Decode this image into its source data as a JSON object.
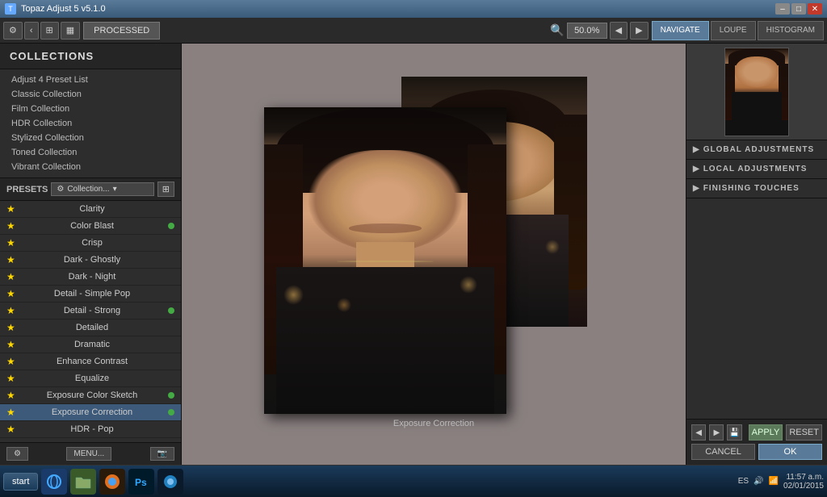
{
  "titlebar": {
    "title": "Topaz Adjust 5 v5.1.0",
    "min": "–",
    "max": "□",
    "close": "✕"
  },
  "toolbar": {
    "nav_left": "‹",
    "nav_right": "›",
    "view_mode1": "⊞",
    "view_mode2": "▦",
    "processed_label": "PROCESSED",
    "zoom_icon": "🔍",
    "zoom_value": "50.0%",
    "nav_prev": "◀",
    "nav_next": "▶"
  },
  "nav_tabs": [
    {
      "id": "navigate",
      "label": "NAVIGATE",
      "active": true
    },
    {
      "id": "loupe",
      "label": "LOUPE",
      "active": false
    },
    {
      "id": "histogram",
      "label": "HISTOGRAM",
      "active": false
    }
  ],
  "collections": {
    "header": "COLLECTIONS",
    "items": [
      {
        "label": "Adjust 4 Preset List"
      },
      {
        "label": "Classic Collection"
      },
      {
        "label": "Film Collection"
      },
      {
        "label": "HDR Collection"
      },
      {
        "label": "Stylized Collection"
      },
      {
        "label": "Toned Collection"
      },
      {
        "label": "Vibrant Collection"
      }
    ]
  },
  "presets": {
    "label": "PRESETS",
    "dropdown_label": "Collection...",
    "grid_icon": "⊞",
    "items": [
      {
        "name": "Clarity",
        "fav": true,
        "dot": false
      },
      {
        "name": "Color Blast",
        "fav": true,
        "dot": true
      },
      {
        "name": "Crisp",
        "fav": true,
        "dot": false
      },
      {
        "name": "Dark - Ghostly",
        "fav": true,
        "dot": false
      },
      {
        "name": "Dark - Night",
        "fav": true,
        "dot": false
      },
      {
        "name": "Detail - Simple Pop",
        "fav": true,
        "dot": false
      },
      {
        "name": "Detail - Strong",
        "fav": true,
        "dot": true
      },
      {
        "name": "Detailed",
        "fav": true,
        "dot": false
      },
      {
        "name": "Dramatic",
        "fav": true,
        "dot": false
      },
      {
        "name": "Enhance Contrast",
        "fav": true,
        "dot": false
      },
      {
        "name": "Equalize",
        "fav": true,
        "dot": false
      },
      {
        "name": "Exposure Color Sketch",
        "fav": true,
        "dot": true
      },
      {
        "name": "Exposure Correction",
        "fav": true,
        "dot": true,
        "active": true
      },
      {
        "name": "HDR - Pop",
        "fav": true,
        "dot": false
      }
    ]
  },
  "canvas": {
    "caption": "Exposure Correction"
  },
  "right_panel": {
    "adjustments": [
      {
        "label": "GLOBAL ADJUSTMENTS"
      },
      {
        "label": "LOCAL ADJUSTMENTS"
      },
      {
        "label": "FINISHING TOUCHES"
      }
    ]
  },
  "buttons": {
    "apply": "APPLY",
    "reset": "RESET",
    "cancel": "CANCEL",
    "ok": "OK",
    "menu": "MENU..."
  },
  "taskbar": {
    "start": "start",
    "tray_lang": "ES",
    "time": "11:57 a.m.",
    "date": "02/01/2015"
  }
}
